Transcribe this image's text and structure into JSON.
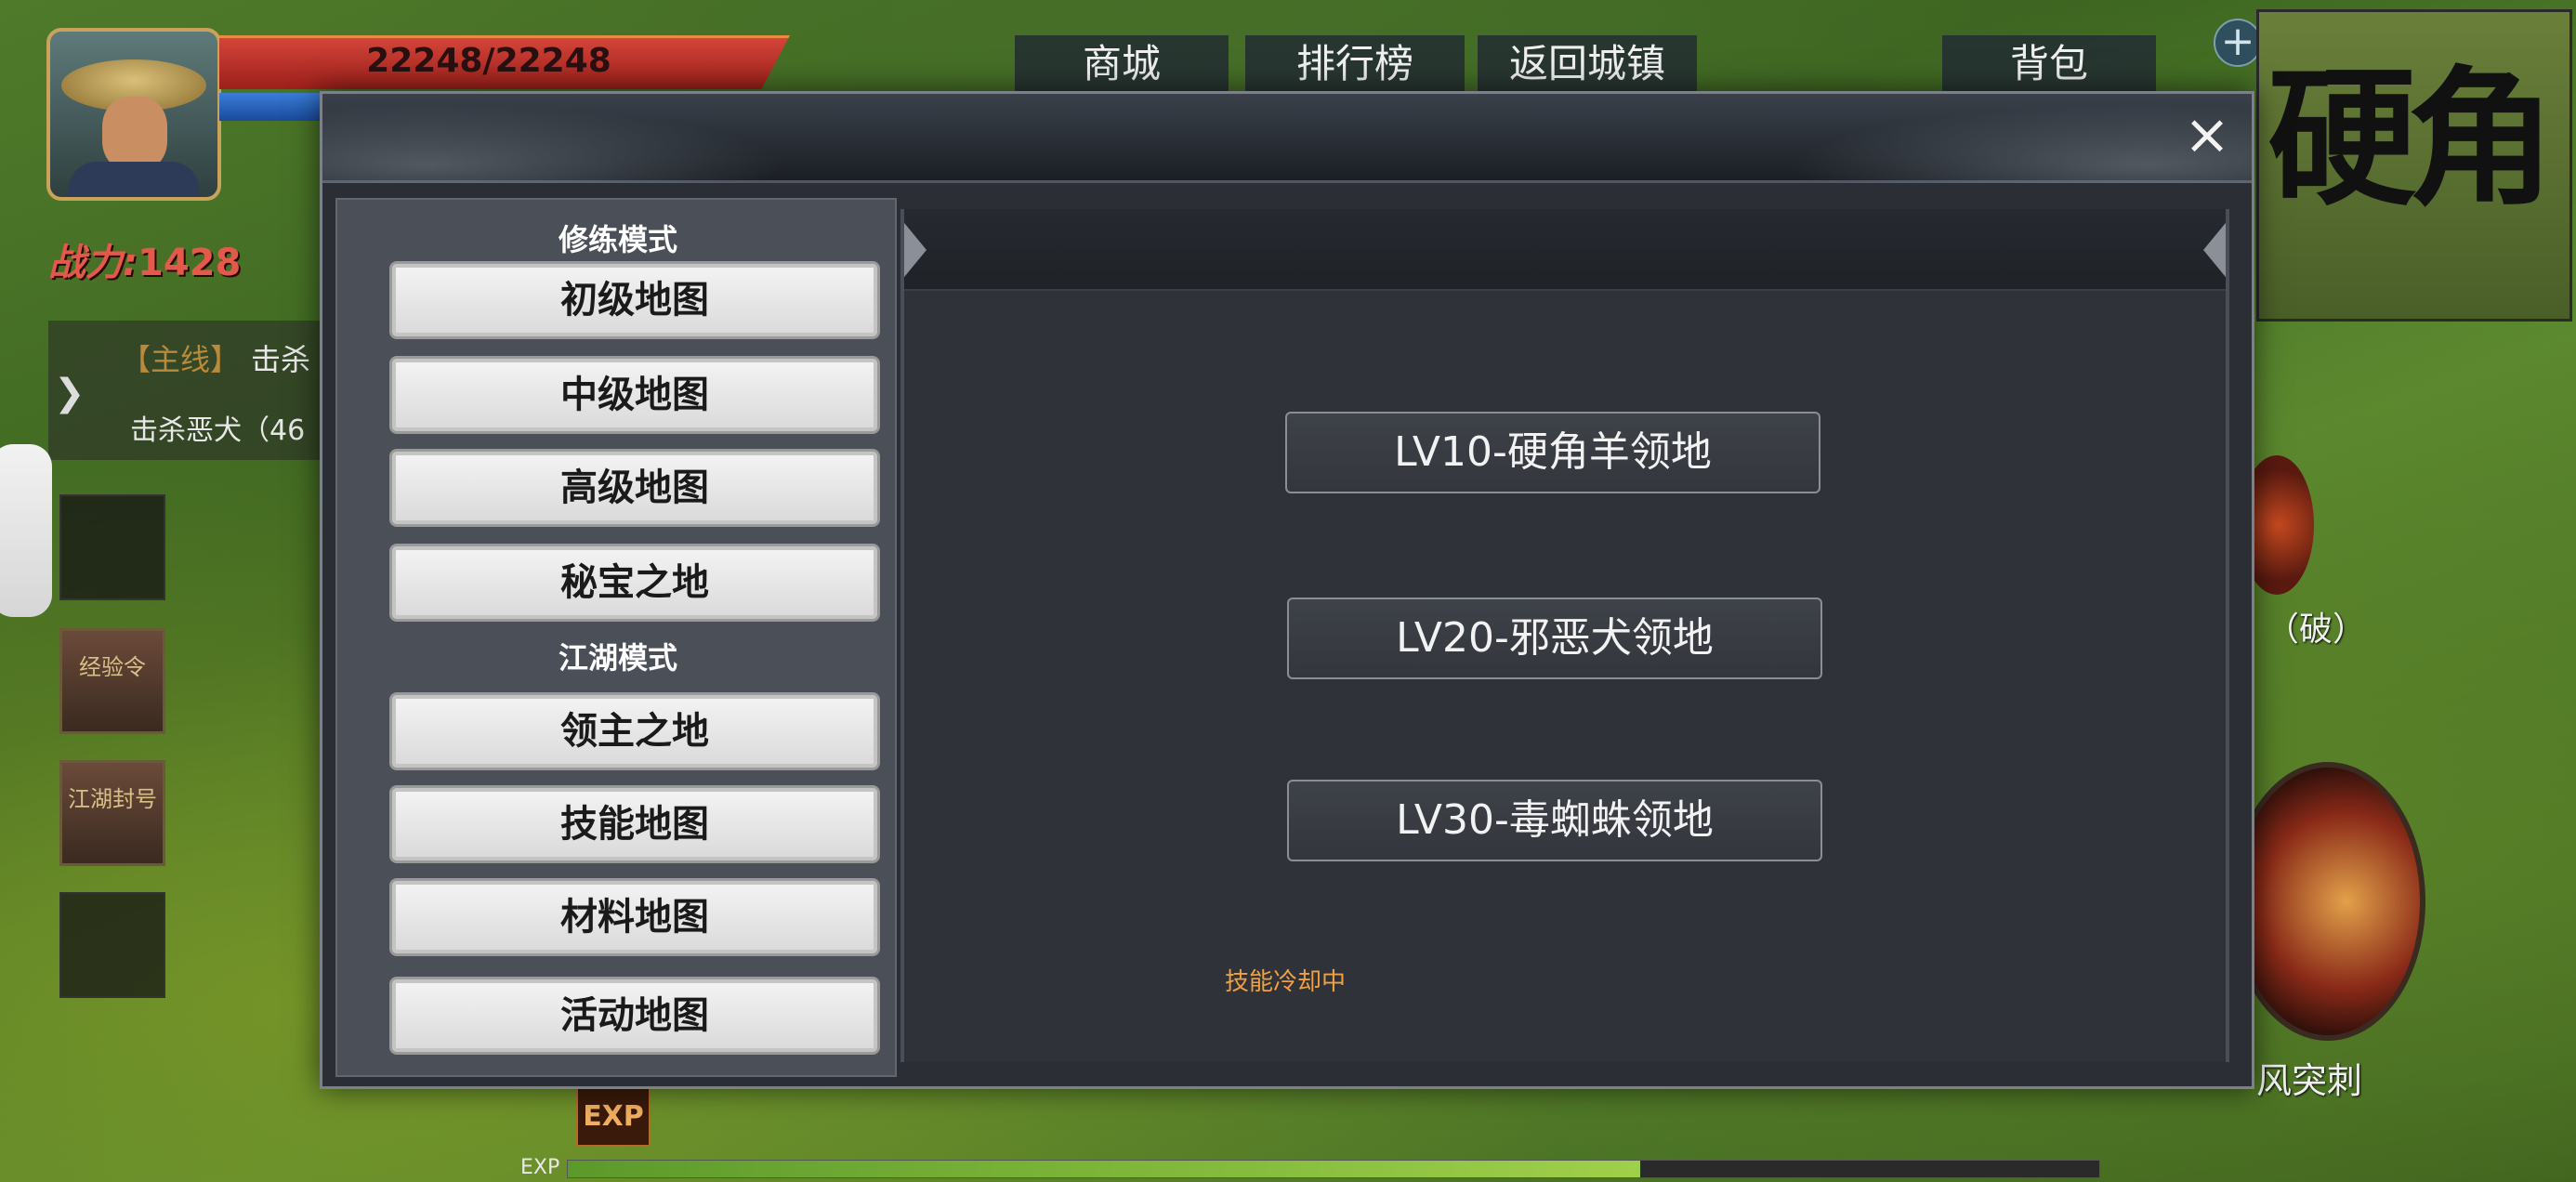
{
  "hud": {
    "hp_text": "22248/22248",
    "power_label": "战力:",
    "power_value": "1428",
    "quest": {
      "tag": "【主线】",
      "line1": "击杀",
      "line2": "击杀恶犬（46"
    },
    "top_buttons": [
      "商城",
      "排行榜",
      "返回城镇",
      "背包"
    ],
    "plus_button": "+",
    "minimap_text": "硬角",
    "item_slots": [
      "经验令",
      "江湖封号"
    ],
    "skill_top_label": "（破）",
    "skill_big_label": "风突刺",
    "exp_badge": "EXP",
    "exp_label": "EXP",
    "exp_progress": 0.7
  },
  "dialog": {
    "close_icon": "×",
    "sections": [
      {
        "title": "修练模式",
        "buttons": [
          "初级地图",
          "中级地图",
          "高级地图",
          "秘宝之地"
        ]
      },
      {
        "title": "江湖模式",
        "buttons": [
          "领主之地",
          "技能地图",
          "材料地图",
          "活动地图"
        ]
      }
    ],
    "territories": [
      "LV10-硬角羊领地",
      "LV20-邪恶犬领地",
      "LV30-毒蜘蛛领地"
    ],
    "status_text": "技能冷却中"
  },
  "colors": {
    "hp": "#d4453a",
    "mp": "#3a7ed8",
    "power": "#e45a4a",
    "cooldown": "#f0a040",
    "dialog_bg": "#2b2e34"
  }
}
